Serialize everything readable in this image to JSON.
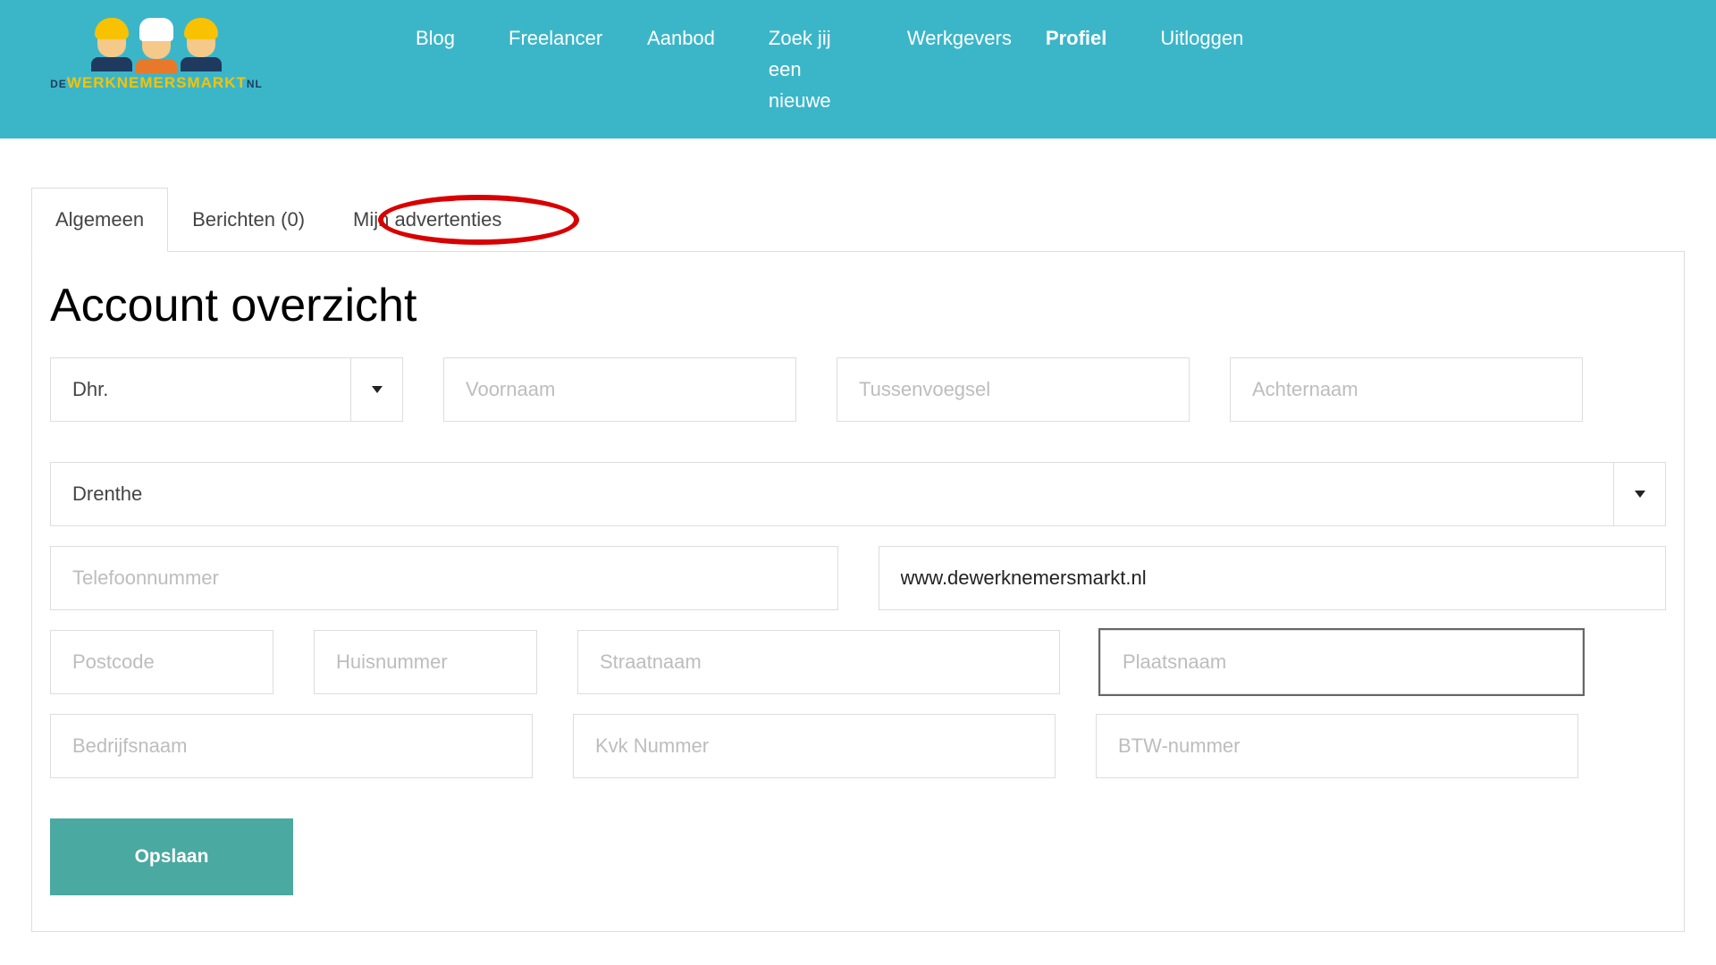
{
  "logo": {
    "de": "DE",
    "main": "WERKNEMERSMARKT",
    "nl": "NL"
  },
  "nav": {
    "blog": "Blog",
    "freelancer": "Freelancer",
    "aanbod": "Aanbod",
    "zoek": "Zoek jij een nieuwe",
    "werkgevers": "Werkgevers",
    "profiel": "Profiel",
    "uitloggen": "Uitloggen"
  },
  "tabs": {
    "algemeen": "Algemeen",
    "berichten": "Berichten (0)",
    "mijn": "Mijn advertenties"
  },
  "page_title": "Account overzicht",
  "form": {
    "title_select": "Dhr.",
    "voornaam_ph": "Voornaam",
    "tussen_ph": "Tussenvoegsel",
    "achternaam_ph": "Achternaam",
    "province_select": "Drenthe",
    "telefoon_ph": "Telefoonnummer",
    "website_value": "www.dewerknemersmarkt.nl",
    "postcode_ph": "Postcode",
    "huisnummer_ph": "Huisnummer",
    "straat_ph": "Straatnaam",
    "plaats_ph": "Plaatsnaam",
    "bedrijf_ph": "Bedrijfsnaam",
    "kvk_ph": "Kvk Nummer",
    "btw_ph": "BTW-nummer",
    "save_label": "Opslaan"
  }
}
